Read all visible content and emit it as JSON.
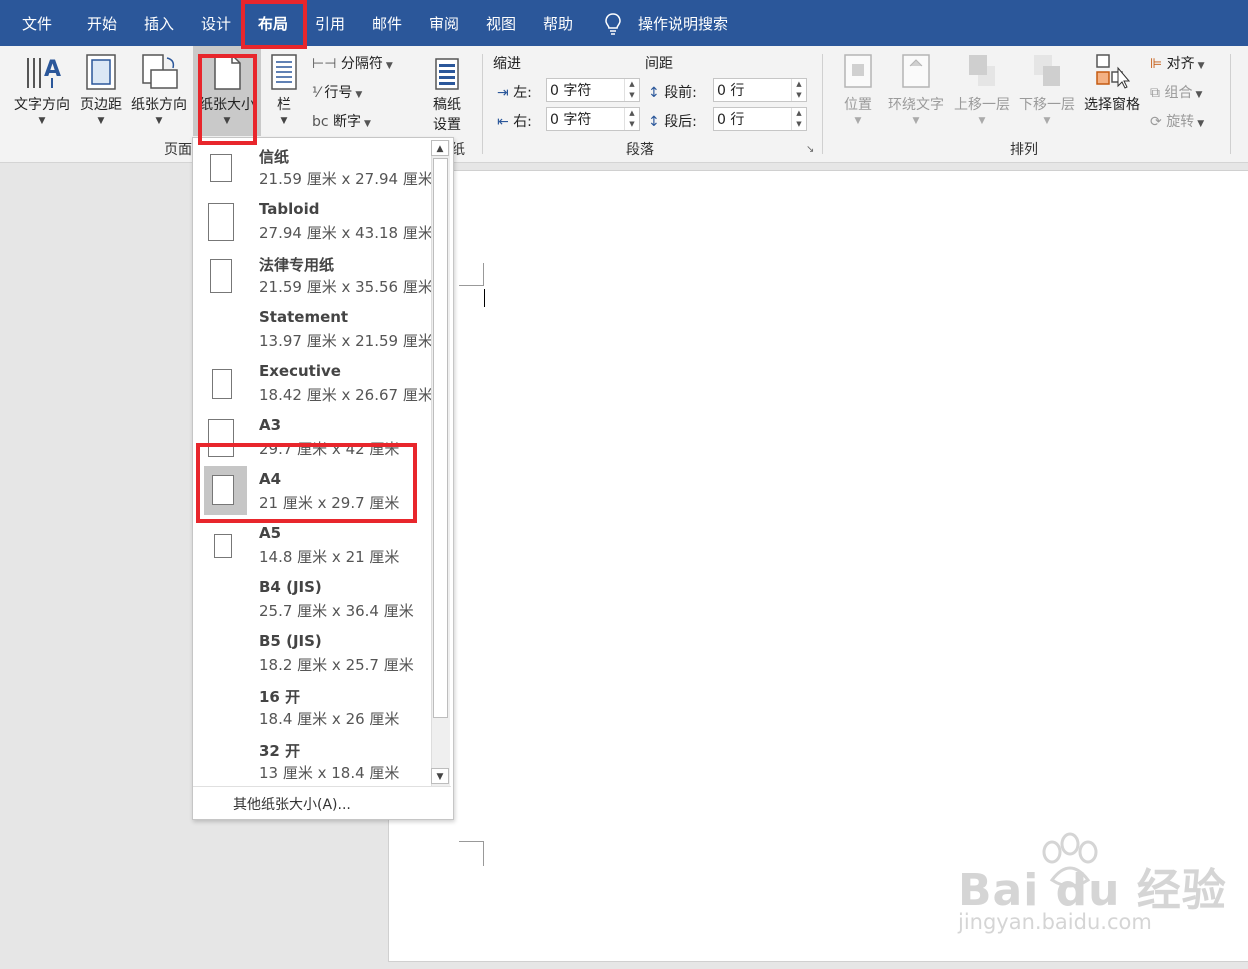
{
  "tabs": [
    {
      "label": "文件"
    },
    {
      "label": "开始"
    },
    {
      "label": "插入"
    },
    {
      "label": "设计"
    },
    {
      "label": "布局"
    },
    {
      "label": "引用"
    },
    {
      "label": "邮件"
    },
    {
      "label": "审阅"
    },
    {
      "label": "视图"
    },
    {
      "label": "帮助"
    }
  ],
  "search_label": "操作说明搜索",
  "ribbon": {
    "page_setup": {
      "text_direction": "文字方向",
      "margins": "页边距",
      "orientation": "纸张方向",
      "size": "纸张大小",
      "columns": "栏",
      "breaks": "分隔符",
      "line_numbers": "行号",
      "hyphenation": "断字",
      "group_label": "页面"
    },
    "manuscript": {
      "label": "稿纸\n设置",
      "label_line1": "稿纸",
      "label_line2": "设置",
      "group_label": "纸"
    },
    "paragraph": {
      "indent_title": "缩进",
      "spacing_title": "间距",
      "left_label": "左:",
      "left_value": "0 字符",
      "right_label": "右:",
      "right_value": "0 字符",
      "before_label": "段前:",
      "before_value": "0 行",
      "after_label": "段后:",
      "after_value": "0 行",
      "group_label": "段落"
    },
    "arrange": {
      "position": "位置",
      "wrap_text": "环绕文字",
      "bring_forward": "上移一层",
      "send_backward": "下移一层",
      "selection_pane": "选择窗格",
      "align": "对齐",
      "group": "组合",
      "rotate": "旋转",
      "group_label": "排列"
    }
  },
  "paper_sizes": [
    {
      "name": "信纸",
      "dims": "21.59 厘米 x 27.94 厘米"
    },
    {
      "name": "Tabloid",
      "dims": "27.94 厘米 x 43.18 厘米"
    },
    {
      "name": "法律专用纸",
      "dims": "21.59 厘米 x 35.56 厘米"
    },
    {
      "name": "Statement",
      "dims": "13.97 厘米 x 21.59 厘米"
    },
    {
      "name": "Executive",
      "dims": "18.42 厘米 x 26.67 厘米"
    },
    {
      "name": "A3",
      "dims": "29.7 厘米 x 42 厘米"
    },
    {
      "name": "A4",
      "dims": "21 厘米 x 29.7 厘米",
      "selected": true
    },
    {
      "name": "A5",
      "dims": "14.8 厘米 x 21 厘米"
    },
    {
      "name": "B4 (JIS)",
      "dims": "25.7 厘米 x 36.4 厘米"
    },
    {
      "name": "B5 (JIS)",
      "dims": "18.2 厘米 x 25.7 厘米"
    },
    {
      "name": "16 开",
      "dims": "18.4 厘米 x 26 厘米"
    },
    {
      "name": "32 开",
      "dims": "13 厘米 x 18.4 厘米"
    }
  ],
  "more_sizes_label": "其他纸张大小(A)...",
  "watermark": {
    "brand": "Bai du 经验",
    "site": "jingyan.baidu.com"
  },
  "colors": {
    "accent": "#2b579a",
    "highlight": "#e8262c"
  }
}
